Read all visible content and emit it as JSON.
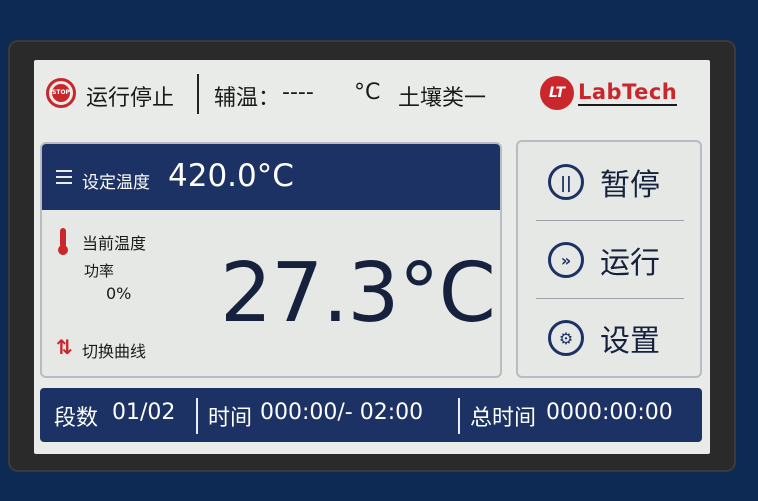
{
  "header": {
    "stop_icon_text": "STOP",
    "status": "运行停止",
    "aux_label": "辅温：",
    "aux_value": "----",
    "aux_unit": "°C",
    "soil_type": "土壤类一",
    "logo_mark": "LT",
    "logo_text": "LabTech"
  },
  "setpoint": {
    "label": "设定温度",
    "value": "420.0°C"
  },
  "current": {
    "label": "当前温度",
    "power_label": "功率",
    "power_value": "0%",
    "temperature": "27.3°C",
    "switch_label": "切换曲线"
  },
  "controls": {
    "pause_label": "暂停",
    "run_label": "运行",
    "settings_label": "设置"
  },
  "footer": {
    "segment_label": "段数",
    "segment_value": "01/02",
    "time_label": "时间",
    "time_value": "000:00/- 02:00",
    "total_label": "总时间",
    "total_value": "0000:00:00"
  },
  "icons": {
    "stop": "stop-icon",
    "setpoint": "setpoint-icon",
    "thermometer": "thermometer-icon",
    "switch_curve": "switch-curve-icon",
    "pause": "pause-icon",
    "run": "run-icon",
    "settings": "gear-icon"
  },
  "colors": {
    "accent_blue": "#1c3264",
    "alert_red": "#c9272b",
    "screen_bg": "#e9ebe8"
  }
}
